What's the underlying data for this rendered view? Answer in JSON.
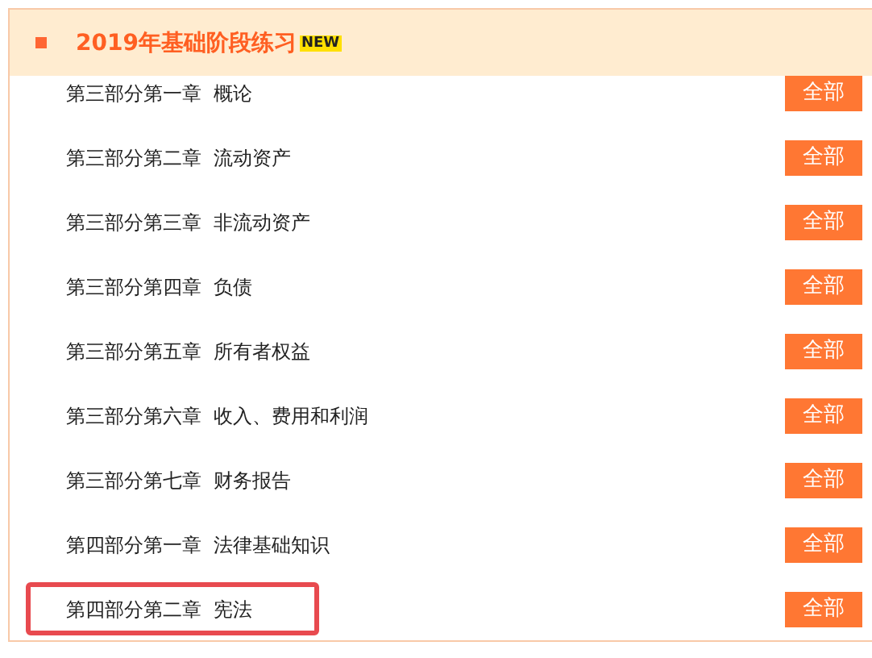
{
  "section": {
    "title": "2019年基础阶段练习",
    "badge": "NEW"
  },
  "chapters": [
    {
      "title": "第三部分第一章  概论",
      "button": "全部",
      "highlighted": false
    },
    {
      "title": "第三部分第二章  流动资产",
      "button": "全部",
      "highlighted": false
    },
    {
      "title": "第三部分第三章  非流动资产",
      "button": "全部",
      "highlighted": false
    },
    {
      "title": "第三部分第四章  负债",
      "button": "全部",
      "highlighted": false
    },
    {
      "title": "第三部分第五章  所有者权益",
      "button": "全部",
      "highlighted": false
    },
    {
      "title": "第三部分第六章  收入、费用和利润",
      "button": "全部",
      "highlighted": false
    },
    {
      "title": "第三部分第七章  财务报告",
      "button": "全部",
      "highlighted": false
    },
    {
      "title": "第四部分第一章  法律基础知识",
      "button": "全部",
      "highlighted": false
    },
    {
      "title": "第四部分第二章  宪法",
      "button": "全部",
      "highlighted": true
    }
  ]
}
